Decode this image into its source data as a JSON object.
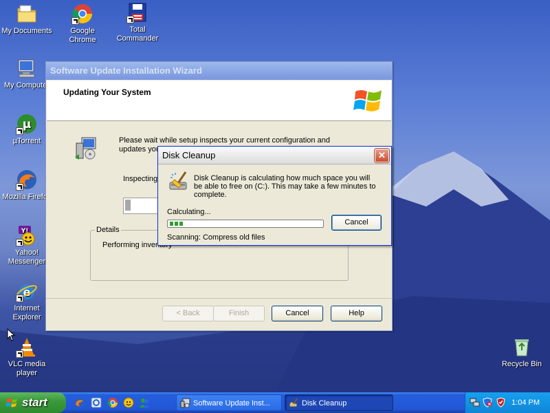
{
  "desktop": {
    "icons": [
      {
        "label": "My Documents"
      },
      {
        "label": "Google Chrome"
      },
      {
        "label": "Total Commander"
      },
      {
        "label": "My Computer"
      },
      {
        "label": "µTorrent"
      },
      {
        "label": "Mozilla Firefox"
      },
      {
        "label": "Yahoo! Messenger"
      },
      {
        "label": "Internet Explorer"
      },
      {
        "label": "VLC media player"
      },
      {
        "label": "Recycle Bin"
      }
    ]
  },
  "wizard": {
    "title": "Software Update Installation Wizard",
    "header": "Updating Your System",
    "message": "Please wait while setup inspects your current configuration and updates your files.",
    "inspecting": "Inspecting",
    "details_label": "Details",
    "details_text": "Performing inventory",
    "buttons": {
      "back": "< Back",
      "finish": "Finish",
      "cancel": "Cancel",
      "help": "Help"
    }
  },
  "disk_cleanup": {
    "title": "Disk Cleanup",
    "close": "✕",
    "message": "Disk Cleanup is calculating how much space you will be able to free on  (C:). This may take a few minutes to complete.",
    "calculating": "Calculating...",
    "cancel": "Cancel",
    "scanning": "Scanning:   Compress old files",
    "progress_segments": 3
  },
  "taskbar": {
    "start": "start",
    "tasks": [
      {
        "label": "Software Update Inst..."
      },
      {
        "label": "Disk Cleanup"
      }
    ],
    "clock": "1:04 PM"
  },
  "colors": {
    "title_active": "#0831d9",
    "taskbar_blue": "#245edc",
    "start_green": "#3c9a3c",
    "progress_green": "#2ea02e"
  }
}
